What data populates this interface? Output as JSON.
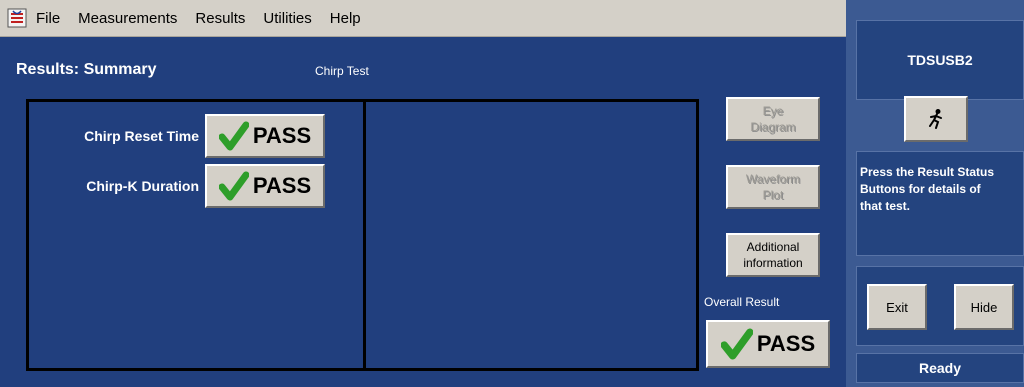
{
  "menu": {
    "icon": "tektronix-app-icon",
    "items": [
      "File",
      "Measurements",
      "Results",
      "Utilities",
      "Help"
    ]
  },
  "main": {
    "title": "Results: Summary",
    "subtitle": "Chirp Test",
    "tests": [
      {
        "label": "Chirp Reset Time",
        "result": "PASS"
      },
      {
        "label": "Chirp-K Duration",
        "result": "PASS"
      }
    ],
    "buttons": {
      "eye_diagram": "Eye\nDiagram",
      "waveform_plot": "Waveform\nPlot",
      "additional_info": "Additional\ninformation"
    },
    "overall_label": "Overall Result",
    "overall_result": "PASS"
  },
  "sidebar": {
    "header": "TDSUSB2",
    "icon_button": "running-man-icon",
    "message": "Press the Result Status\nButtons for details of\nthat test.",
    "exit_label": "Exit",
    "hide_label": "Hide",
    "status": "Ready"
  },
  "colors": {
    "panel_blue": "#213f7e",
    "sidebar_blue": "#3c5a92",
    "check_green": "#2e9e2a",
    "button_gray": "#d4d0c8"
  }
}
